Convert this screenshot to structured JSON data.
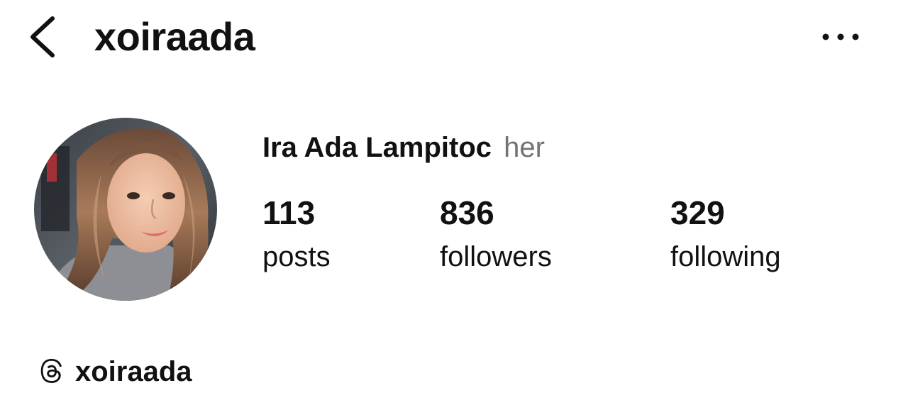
{
  "header": {
    "username": "xoiraada",
    "back_icon": "chevron-left-icon",
    "more_icon": "more-horizontal-icon"
  },
  "profile": {
    "display_name": "Ira Ada Lampitoc",
    "pronouns": "her",
    "avatar": "profile-photo"
  },
  "stats": {
    "posts": {
      "value": "113",
      "label": "posts"
    },
    "followers": {
      "value": "836",
      "label": "followers"
    },
    "following": {
      "value": "329",
      "label": "following"
    }
  },
  "threads": {
    "icon": "threads-icon",
    "handle": "xoiraada"
  },
  "colors": {
    "text": "#111111",
    "secondary_text": "#737373",
    "background": "#ffffff"
  }
}
